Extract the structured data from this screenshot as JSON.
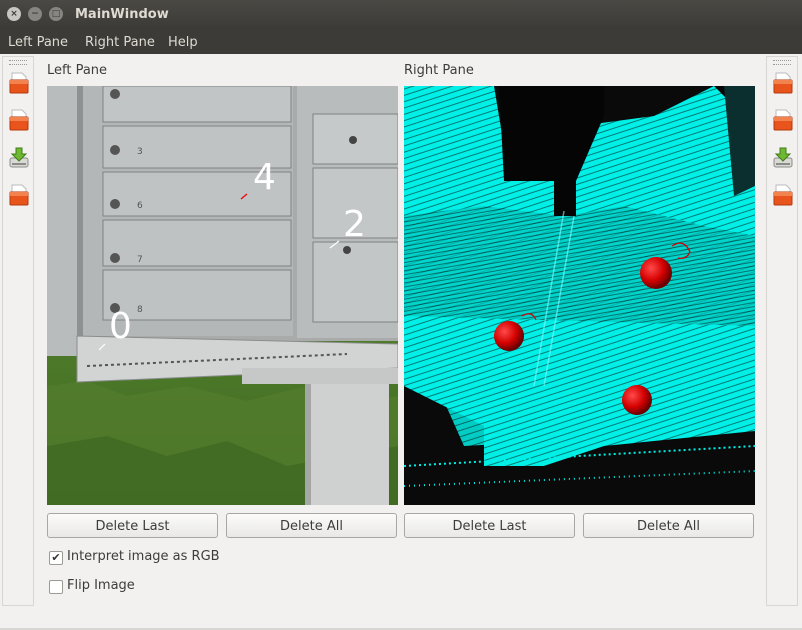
{
  "window": {
    "title": "MainWindow",
    "close_glyph": "×",
    "minimize_glyph": "−",
    "maximize_glyph": "□"
  },
  "menu": {
    "items": [
      "Left Pane",
      "Right Pane",
      "Help"
    ]
  },
  "left_pane": {
    "label": "Left Pane",
    "markers": [
      "0",
      "4",
      "2"
    ],
    "mailbox_numbers": [
      "3",
      "6",
      "7",
      "8"
    ],
    "delete_last": "Delete Last",
    "delete_all": "Delete All"
  },
  "right_pane": {
    "label": "Right Pane",
    "delete_last": "Delete Last",
    "delete_all": "Delete All"
  },
  "options": {
    "interpret_rgb": {
      "label": "Interpret image as RGB",
      "checked": true,
      "mark": "✔"
    },
    "flip_image": {
      "label": "Flip Image",
      "checked": false
    }
  },
  "toolbars": {
    "left": [
      "open-document-icon",
      "open-document-icon",
      "download-icon",
      "open-document-icon"
    ],
    "right": [
      "open-document-icon",
      "open-document-icon",
      "download-icon",
      "open-document-icon"
    ]
  },
  "colors": {
    "cyan": "#00fff0",
    "marker_red": "#d40000",
    "title_bg": "#3c3b37"
  }
}
